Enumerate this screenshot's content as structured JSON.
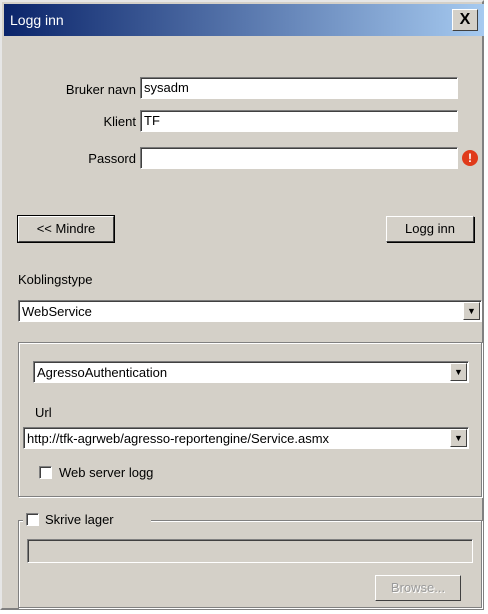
{
  "window": {
    "title": "Logg inn",
    "close_label": "X"
  },
  "form": {
    "username_label": "Bruker navn",
    "username_value": "sysadm",
    "client_label": "Klient",
    "client_value": "TF",
    "password_label": "Passord",
    "password_value": "",
    "error_icon": "!"
  },
  "buttons": {
    "less_label": "<< Mindre",
    "login_label": "Logg inn"
  },
  "connection": {
    "type_label": "Koblingstype",
    "type_value": "WebService",
    "auth_value": "AgressoAuthentication",
    "url_label": "Url",
    "url_value": "http://tfk-agrweb/agresso-reportengine/Service.asmx",
    "web_log_label": "Web server logg",
    "web_log_checked": false,
    "arrow_icon": "▼"
  },
  "storage": {
    "label": "Skrive lager",
    "checked": false,
    "path_value": "",
    "browse_label": "Browse..."
  },
  "colors": {
    "title_bar": "#0a246a",
    "error": "#e03a1a",
    "face": "#d4d0c8"
  }
}
